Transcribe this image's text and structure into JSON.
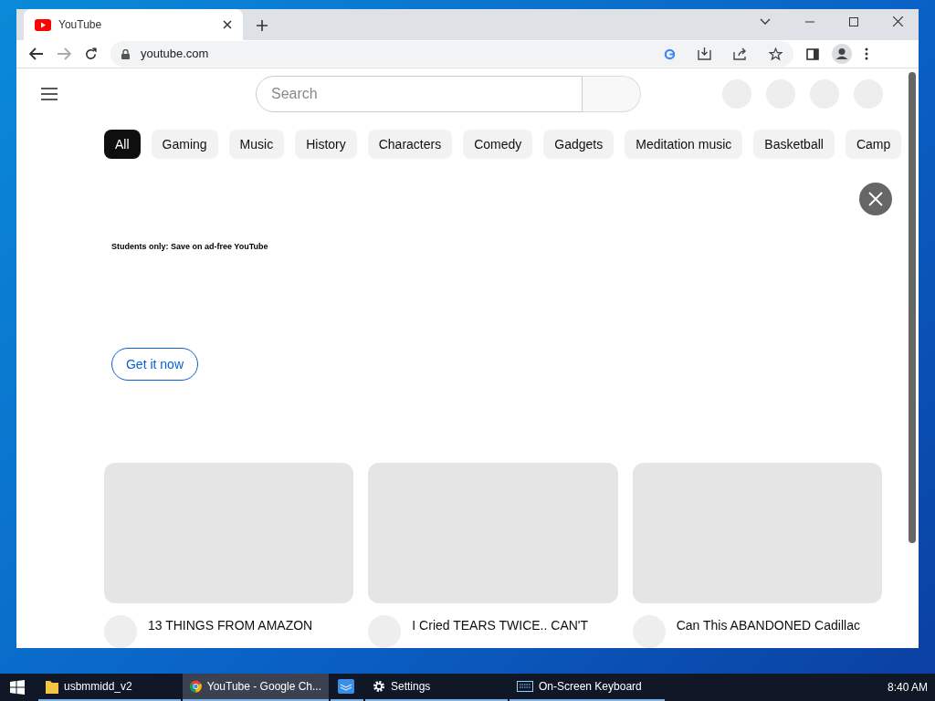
{
  "browser": {
    "tab": {
      "title": "YouTube"
    },
    "address": "youtube.com"
  },
  "page": {
    "search": {
      "placeholder": "Search"
    },
    "chips": [
      {
        "label": "All",
        "selected": true
      },
      {
        "label": "Gaming",
        "selected": false
      },
      {
        "label": "Music",
        "selected": false
      },
      {
        "label": "History",
        "selected": false
      },
      {
        "label": "Characters",
        "selected": false
      },
      {
        "label": "Comedy",
        "selected": false
      },
      {
        "label": "Gadgets",
        "selected": false
      },
      {
        "label": "Meditation music",
        "selected": false
      },
      {
        "label": "Basketball",
        "selected": false
      },
      {
        "label": "Camp",
        "selected": false
      }
    ],
    "promo": {
      "text": "Students only: Save on ad-free YouTube",
      "button": "Get it now"
    },
    "videos": [
      {
        "title": "13 THINGS FROM AMAZON"
      },
      {
        "title": "I Cried TEARS TWICE.. CAN'T"
      },
      {
        "title": "Can This ABANDONED Cadillac"
      }
    ]
  },
  "taskbar": {
    "items": [
      {
        "label": "usbmmidd_v2",
        "kind": "folder",
        "selected": false
      },
      {
        "label": "YouTube - Google Ch...",
        "kind": "chrome",
        "selected": true
      },
      {
        "kind": "app",
        "selected": false
      },
      {
        "label": "Settings",
        "kind": "settings",
        "selected": false
      },
      {
        "label": "On-Screen Keyboard",
        "kind": "keyboard",
        "selected": false
      }
    ],
    "clock": "8:40 AM"
  }
}
